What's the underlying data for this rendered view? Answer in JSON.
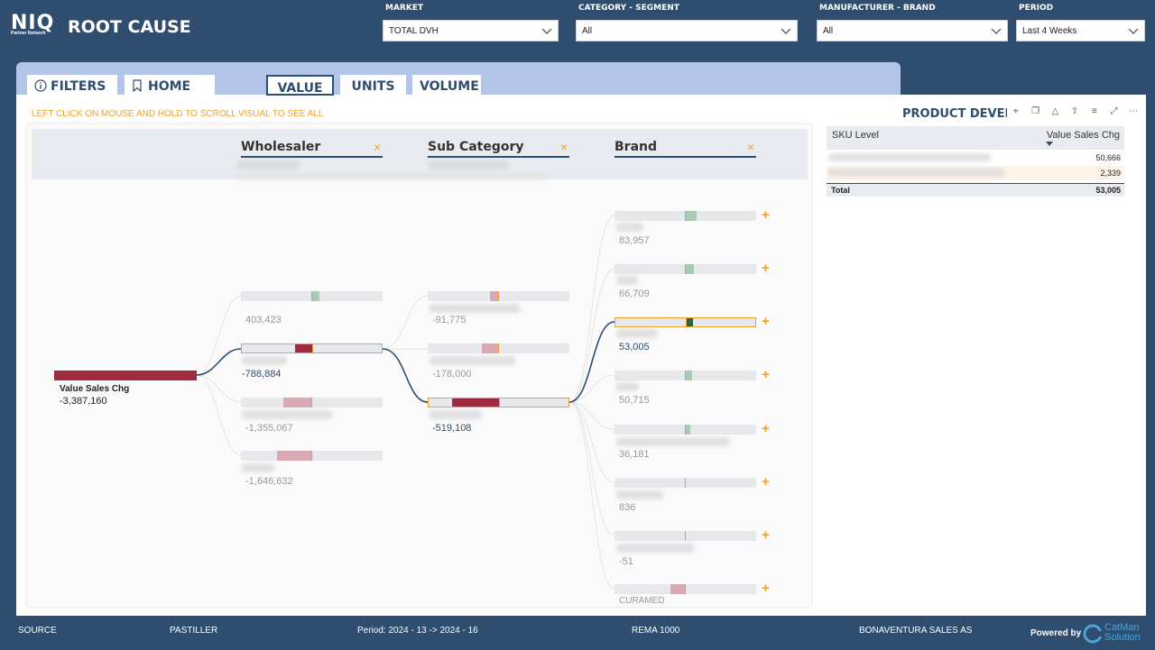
{
  "header": {
    "logo": "NIQ",
    "logo_sub": "Partner Network",
    "title": "ROOT CAUSE"
  },
  "filters": {
    "market": {
      "label": "MARKET",
      "value": "TOTAL DVH"
    },
    "category": {
      "label": "CATEGORY - SEGMENT",
      "value": "All"
    },
    "manufacturer": {
      "label": "MANUFACTURER - BRAND",
      "value": "All"
    },
    "period": {
      "label": "PERIOD",
      "value": "Last 4 Weeks"
    }
  },
  "tabs": {
    "filters": "FILTERS",
    "home": "HOME",
    "value": "VALUE",
    "units": "UNITS",
    "volume": "VOLUME"
  },
  "hint": "LEFT CLICK ON MOUSE AND HOLD TO SCROLL VISUAL TO SEE ALL",
  "tree": {
    "columns": {
      "wholesaler": "Wholesaler",
      "sub_category": "Sub Category",
      "brand": "Brand"
    },
    "close_glyph": "×",
    "expand_glyph": "+",
    "root": {
      "label": "Value Sales Chg",
      "value": "-3,387,160"
    },
    "wholesaler_values": [
      "403,423",
      "-788,884",
      "-1,355,067",
      "-1,646,632"
    ],
    "subcat_values": [
      "-91,775",
      "-178,000",
      "-519,108"
    ],
    "brand_values": [
      "83,957",
      "66,709",
      "53,005",
      "50,715",
      "36,181",
      "836",
      "-51"
    ],
    "brand_last_label": "CURAMED"
  },
  "table": {
    "title": "PRODUCT DEVELOPMENT",
    "col1": "SKU Level",
    "col2": "Value Sales Chg",
    "rows": [
      "50,666",
      "2,339"
    ],
    "total_label": "Total",
    "total_value": "53,005"
  },
  "footer": {
    "source": "SOURCE",
    "brand": "PASTILLER",
    "period": "Period: 2024 - 13 -> 2024 - 16",
    "retailer": "REMA 1000",
    "supplier": "BONAVENTURA SALES AS",
    "powered": "Powered by",
    "catman1": "CatMan",
    "catman2": "Solution"
  },
  "colors": {
    "navy": "#2e4d6f",
    "accent": "#f0a02a",
    "negative": "#9e2c3e",
    "positive": "#1f6b44"
  }
}
